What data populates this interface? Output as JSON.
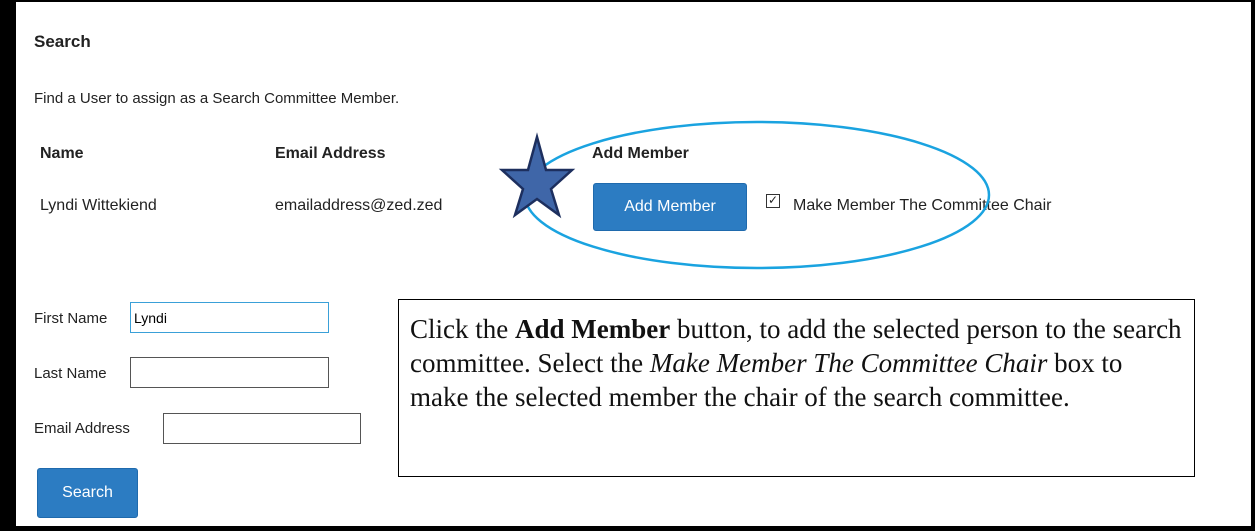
{
  "section": {
    "title": "Search",
    "instruction": "Find a User to assign as a Search Committee Member."
  },
  "table": {
    "headers": [
      "Name",
      "Email Address",
      "Add Member"
    ],
    "rows": [
      {
        "name": "Lyndi Wittekiend",
        "email": "emailaddress@zed.zed",
        "button_label": "Add Member",
        "chair_checked": true,
        "chair_label": "Make Member The Committee Chair"
      }
    ]
  },
  "form": {
    "first_name_label": "First Name",
    "first_name_value": "Lyndi",
    "last_name_label": "Last Name",
    "last_name_value": "",
    "email_label": "Email Address",
    "email_value": "",
    "search_button": "Search"
  },
  "callout": {
    "pre1": "Click the ",
    "bold": "Add Member",
    "mid": " button, to add the selected person to the search committee. Select the ",
    "italic": "Make Member The Committee Chair",
    "post": " box to make the selected member the chair of the search committee."
  },
  "colors": {
    "button": "#2c7cc2",
    "annotation_ellipse": "#1aa3e0",
    "star_fill": "#3f66a8",
    "star_stroke": "#1d2f5e"
  },
  "icons": {
    "checkbox": "checkbox-checked-icon",
    "star": "star-icon"
  }
}
